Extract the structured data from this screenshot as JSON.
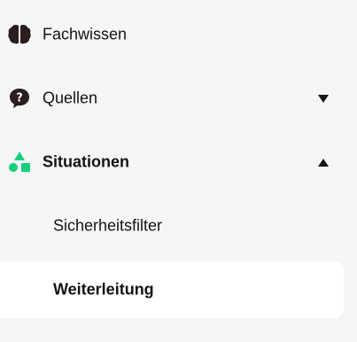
{
  "nav": {
    "items": [
      {
        "label": "Fachwissen",
        "icon": "brain-icon",
        "expanded": null
      },
      {
        "label": "Quellen",
        "icon": "question-bubble-icon",
        "chevron": "chevron-down-icon"
      },
      {
        "label": "Situationen",
        "icon": "shapes-icon",
        "chevron": "chevron-up-icon",
        "subitems": [
          {
            "label": "Sicherheitsfilter",
            "active": false
          },
          {
            "label": "Weiterleitung",
            "active": true
          }
        ]
      }
    ]
  },
  "colors": {
    "background": "#f4f6f7",
    "active_background": "#ffffff",
    "text": "#141414",
    "icon_dark": "#2b1d1d",
    "accent_green": "#16d07a"
  }
}
